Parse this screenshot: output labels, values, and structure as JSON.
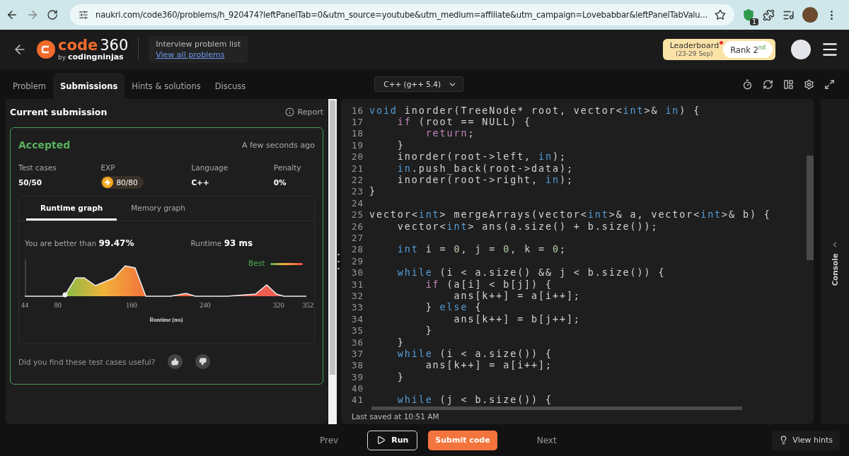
{
  "browser": {
    "url": "naukri.com/code360/problems/h_920474?leftPanelTab=0&utm_source=youtube&utm_medium=affiliate&utm_campaign=Lovebabbar&leftPanelTabValu...",
    "extension_badge": "1"
  },
  "header": {
    "logo": {
      "word": "code",
      "number": "360",
      "by": "by",
      "brand": "codingninjas"
    },
    "breadcrumb": {
      "title": "Interview problem list",
      "link": "View all problems"
    },
    "leaderboard": {
      "label": "Leaderboard",
      "dates": "(23-29 Sep)",
      "notification": true,
      "rank": "Rank 2$^{nd}$"
    }
  },
  "tabs": [
    {
      "label": "Problem",
      "selected": false
    },
    {
      "label": "Submissions",
      "selected": true
    },
    {
      "label": "Hints & solutions",
      "selected": false
    },
    {
      "label": "Discuss",
      "selected": false
    }
  ],
  "language": "C++ (g++ 5.4)",
  "submission": {
    "title": "Current submission",
    "report": "Report",
    "status": "Accepted",
    "time": "A few seconds ago",
    "stats": [
      {
        "label": "Test cases",
        "value": "50/50",
        "kind": "text"
      },
      {
        "label": "EXP",
        "value": "80/80",
        "kind": "exp"
      },
      {
        "label": "Language",
        "value": "C++",
        "kind": "text"
      },
      {
        "label": "Penalty",
        "value": "0%",
        "kind": "text"
      }
    ],
    "graph_tabs": [
      {
        "label": "Runtime graph",
        "selected": true
      },
      {
        "label": "Memory graph",
        "selected": false
      }
    ],
    "better_label": "You are better than",
    "better_value": "99.47%",
    "runtime_label": "Runtime",
    "runtime_value": "93 ms",
    "legend": "Best",
    "x_ticks": [
      "44",
      "80",
      "160",
      "240",
      "320",
      "352"
    ],
    "x_label": "Runtime (ms)",
    "feedback": "Did you find these test cases useful?"
  },
  "editor": {
    "lines": [
      {
        "number": "16",
        "tokens": [
          {
            "text": "void",
            "kind": "kw"
          },
          {
            "text": " inorder(TreeNode* root, vector<",
            "kind": "plain"
          },
          {
            "text": "int",
            "kind": "kw"
          },
          {
            "text": ">& ",
            "kind": "plain"
          },
          {
            "text": "in",
            "kind": "kw"
          },
          {
            "text": ") {",
            "kind": "plain"
          }
        ]
      },
      {
        "number": "17",
        "tokens": [
          {
            "text": "    if",
            "kind": "ctl"
          },
          {
            "text": " (root == NULL) {",
            "kind": "plain"
          }
        ]
      },
      {
        "number": "18",
        "tokens": [
          {
            "text": "        return",
            "kind": "ctl"
          },
          {
            "text": ";",
            "kind": "plain"
          }
        ]
      },
      {
        "number": "19",
        "tokens": [
          {
            "text": "    }",
            "kind": "plain"
          }
        ]
      },
      {
        "number": "20",
        "tokens": [
          {
            "text": "    inorder(root->left, ",
            "kind": "plain"
          },
          {
            "text": "in",
            "kind": "kw"
          },
          {
            "text": ");",
            "kind": "plain"
          }
        ]
      },
      {
        "number": "21",
        "tokens": [
          {
            "text": "    in",
            "kind": "kw"
          },
          {
            "text": ".push_back(root->data);",
            "kind": "plain"
          }
        ]
      },
      {
        "number": "22",
        "tokens": [
          {
            "text": "    inorder(root->right, ",
            "kind": "plain"
          },
          {
            "text": "in",
            "kind": "kw"
          },
          {
            "text": ");",
            "kind": "plain"
          }
        ]
      },
      {
        "number": "23",
        "tokens": [
          {
            "text": "}",
            "kind": "plain"
          }
        ]
      },
      {
        "number": "24"
      },
      {
        "number": "25",
        "tokens": [
          {
            "text": "vector<",
            "kind": "plain"
          },
          {
            "text": "int",
            "kind": "kw"
          },
          {
            "text": "> mergeArrays(vector<",
            "kind": "plain"
          },
          {
            "text": "int",
            "kind": "kw"
          },
          {
            "text": ">& a, vector<",
            "kind": "plain"
          },
          {
            "text": "int",
            "kind": "kw"
          },
          {
            "text": ">& b) {",
            "kind": "plain"
          }
        ]
      },
      {
        "number": "26",
        "tokens": [
          {
            "text": "    vector<",
            "kind": "plain"
          },
          {
            "text": "int",
            "kind": "kw"
          },
          {
            "text": "> ans(a.size() + b.size());",
            "kind": "plain"
          }
        ]
      },
      {
        "number": "27"
      },
      {
        "number": "28",
        "tokens": [
          {
            "text": "    int",
            "kind": "kw"
          },
          {
            "text": " i = ",
            "kind": "plain"
          },
          {
            "text": "0",
            "kind": "num"
          },
          {
            "text": ", j = ",
            "kind": "plain"
          },
          {
            "text": "0",
            "kind": "num"
          },
          {
            "text": ", k = ",
            "kind": "plain"
          },
          {
            "text": "0",
            "kind": "num"
          },
          {
            "text": ";",
            "kind": "plain"
          }
        ]
      },
      {
        "number": "29"
      },
      {
        "number": "30",
        "tokens": [
          {
            "text": "    while",
            "kind": "kw"
          },
          {
            "text": " (i < a.size() && j < b.size()) {",
            "kind": "plain"
          }
        ]
      },
      {
        "number": "31",
        "tokens": [
          {
            "text": "        if",
            "kind": "ctl"
          },
          {
            "text": " (a[i] < b[j]) {",
            "kind": "plain"
          }
        ]
      },
      {
        "number": "32",
        "tokens": [
          {
            "text": "            ans[k++] = a[i++];",
            "kind": "plain"
          }
        ]
      },
      {
        "number": "33",
        "tokens": [
          {
            "text": "        } ",
            "kind": "plain"
          },
          {
            "text": "else",
            "kind": "kw"
          },
          {
            "text": " {",
            "kind": "plain"
          }
        ]
      },
      {
        "number": "34",
        "tokens": [
          {
            "text": "            ans[k++] = b[j++];",
            "kind": "plain"
          }
        ]
      },
      {
        "number": "35",
        "tokens": [
          {
            "text": "        }",
            "kind": "plain"
          }
        ]
      },
      {
        "number": "36",
        "tokens": [
          {
            "text": "    }",
            "kind": "plain"
          }
        ]
      },
      {
        "number": "37",
        "tokens": [
          {
            "text": "    while",
            "kind": "kw"
          },
          {
            "text": " (i < a.size()) {",
            "kind": "plain"
          }
        ]
      },
      {
        "number": "38",
        "tokens": [
          {
            "text": "        ans[k++] = a[i++];",
            "kind": "plain"
          }
        ]
      },
      {
        "number": "39",
        "tokens": [
          {
            "text": "    }",
            "kind": "plain"
          }
        ]
      },
      {
        "number": "40"
      },
      {
        "number": "41",
        "tokens": [
          {
            "text": "    while",
            "kind": "kw"
          },
          {
            "text": " (j < b.size()) {",
            "kind": "plain"
          }
        ]
      }
    ],
    "status": "Last saved at 10:51 AM"
  },
  "console": {
    "label": "Console"
  },
  "footer": {
    "prev": "Prev",
    "run": "Run",
    "submit": "Submit code",
    "next": "Next",
    "hints": "View hints"
  }
}
